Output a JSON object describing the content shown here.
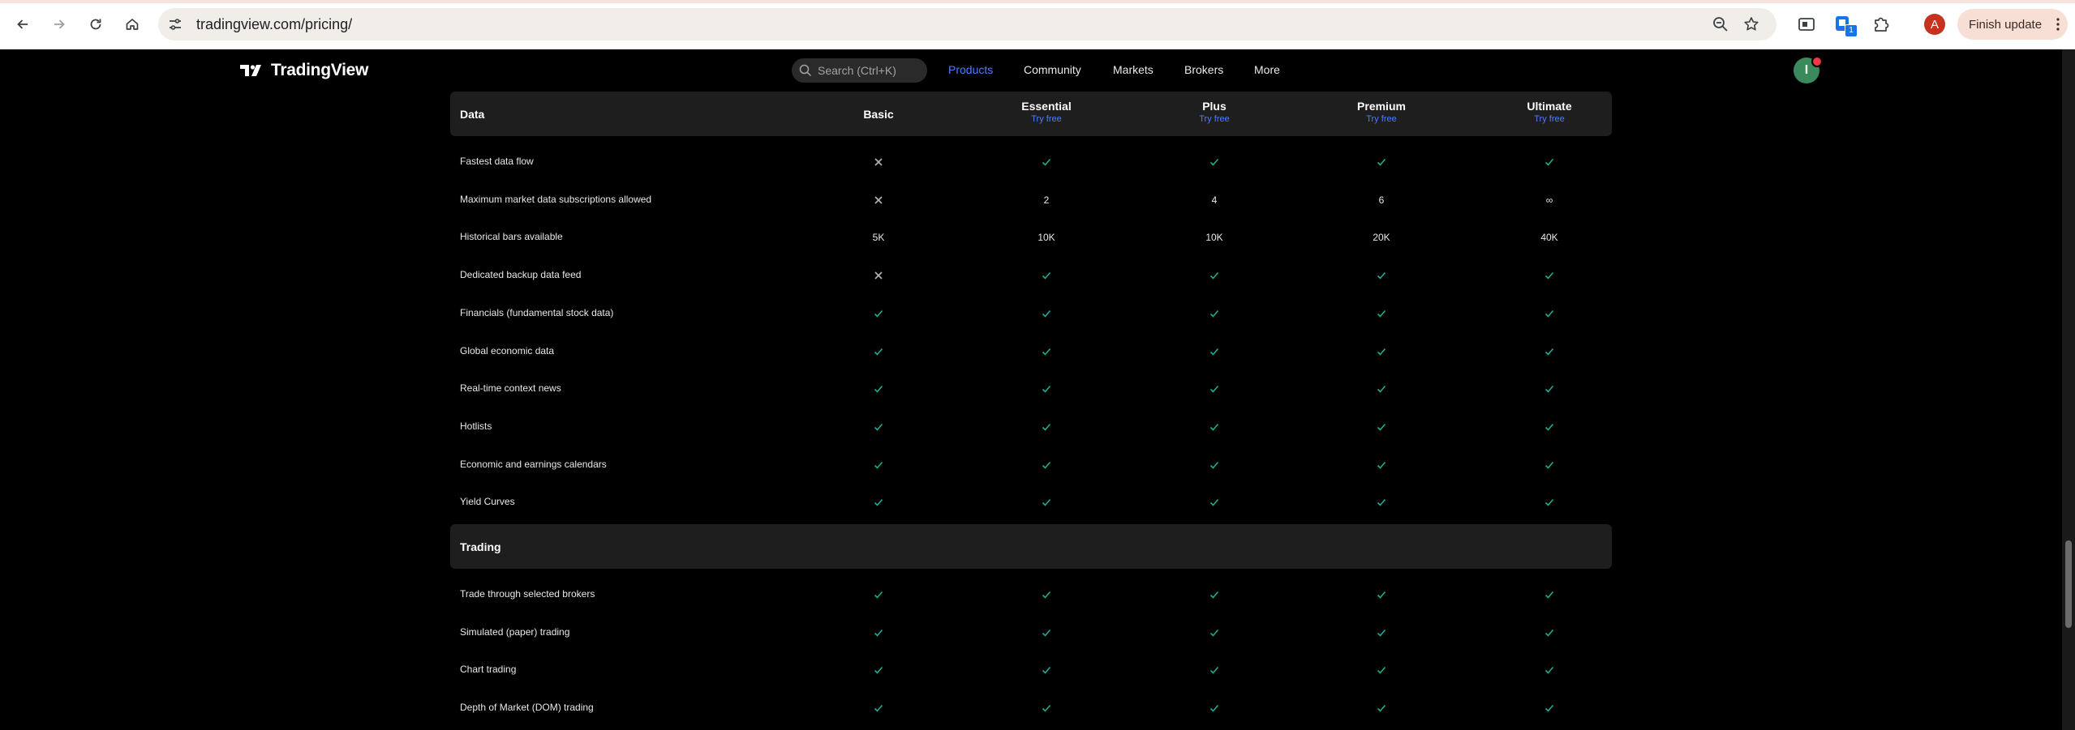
{
  "browser": {
    "url": "tradingview.com/pricing/",
    "profile_initial": "A",
    "extension_badge": "1",
    "finish_update_label": "Finish update",
    "icons": [
      "back-icon",
      "forward-icon",
      "reload-icon",
      "home-icon",
      "site-info-icon",
      "zoom-icon",
      "bookmark-star-icon",
      "extension-icon",
      "puzzle-icon",
      "more-vert-icon"
    ]
  },
  "header": {
    "logo_text": "TradingView",
    "search_placeholder": "Search (Ctrl+K)",
    "nav": [
      {
        "label": "Products",
        "active": true
      },
      {
        "label": "Community",
        "active": false
      },
      {
        "label": "Markets",
        "active": false
      },
      {
        "label": "Brokers",
        "active": false
      },
      {
        "label": "More",
        "active": false
      }
    ],
    "avatar_initial": "I"
  },
  "plans": [
    {
      "name": "Basic",
      "try": ""
    },
    {
      "name": "Essential",
      "try": "Try free"
    },
    {
      "name": "Plus",
      "try": "Try free"
    },
    {
      "name": "Premium",
      "try": "Try free"
    },
    {
      "name": "Ultimate",
      "try": "Try free"
    }
  ],
  "sections": [
    {
      "title": "Data",
      "show_plans": true,
      "rows": [
        {
          "label": "Fastest data flow",
          "cells": [
            "x",
            "check",
            "check",
            "check",
            "check"
          ]
        },
        {
          "label": "Maximum market data subscriptions allowed",
          "cells": [
            "x",
            "2",
            "4",
            "6",
            "∞"
          ]
        },
        {
          "label": "Historical bars available",
          "cells": [
            "5K",
            "10K",
            "10K",
            "20K",
            "40K"
          ]
        },
        {
          "label": "Dedicated backup data feed",
          "cells": [
            "x",
            "check",
            "check",
            "check",
            "check"
          ]
        },
        {
          "label": "Financials (fundamental stock data)",
          "cells": [
            "check",
            "check",
            "check",
            "check",
            "check"
          ]
        },
        {
          "label": "Global economic data",
          "cells": [
            "check",
            "check",
            "check",
            "check",
            "check"
          ]
        },
        {
          "label": "Real-time context news",
          "cells": [
            "check",
            "check",
            "check",
            "check",
            "check"
          ]
        },
        {
          "label": "Hotlists",
          "cells": [
            "check",
            "check",
            "check",
            "check",
            "check"
          ]
        },
        {
          "label": "Economic and earnings calendars",
          "cells": [
            "check",
            "check",
            "check",
            "check",
            "check"
          ]
        },
        {
          "label": "Yield Curves",
          "cells": [
            "check",
            "check",
            "check",
            "check",
            "check"
          ]
        }
      ]
    },
    {
      "title": "Trading",
      "show_plans": false,
      "rows": [
        {
          "label": "Trade through selected brokers",
          "cells": [
            "check",
            "check",
            "check",
            "check",
            "check"
          ]
        },
        {
          "label": "Simulated (paper) trading",
          "cells": [
            "check",
            "check",
            "check",
            "check",
            "check"
          ]
        },
        {
          "label": "Chart trading",
          "cells": [
            "check",
            "check",
            "check",
            "check",
            "check"
          ]
        },
        {
          "label": "Depth of Market (DOM) trading",
          "cells": [
            "check",
            "check",
            "check",
            "check",
            "check"
          ]
        }
      ]
    }
  ],
  "colors": {
    "check": "#22ab94",
    "cross": "#b2b5be",
    "link": "#4c7dff",
    "section_bg": "#1e1e1e"
  }
}
